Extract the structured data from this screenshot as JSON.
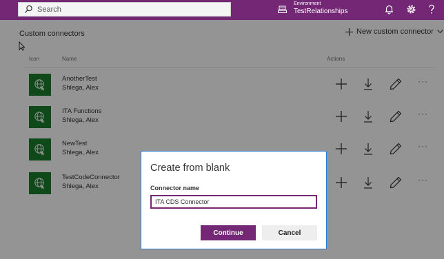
{
  "header": {
    "search_placeholder": "Search",
    "environment_label": "Environment",
    "environment_name": "TestRelationships",
    "icons": [
      "search-icon",
      "environment-icon",
      "bell-icon",
      "gear-icon",
      "help-icon"
    ]
  },
  "page": {
    "title": "Custom connectors",
    "new_connector_label": "New custom connector",
    "columns": {
      "icon": "Icon",
      "name": "Name",
      "actions": "Actions"
    }
  },
  "connectors": [
    {
      "name": "AnotherTest",
      "owner": "Shlega, Alex"
    },
    {
      "name": "ITA Functions",
      "owner": "Shlega, Alex"
    },
    {
      "name": "NewTest",
      "owner": "Shlega, Alex"
    },
    {
      "name": "TestCodeConnector",
      "owner": "Shlega, Alex"
    }
  ],
  "actions": [
    "add-icon",
    "download-icon",
    "edit-icon",
    "more-icon"
  ],
  "dialog": {
    "title": "Create from blank",
    "field_label": "Connector name",
    "field_value": "ITA CDS Connector",
    "continue_label": "Continue",
    "cancel_label": "Cancel"
  },
  "colors": {
    "brand": "#742774",
    "connector_icon": "#1c7e2c",
    "dialog_border": "#2d7bd8"
  }
}
